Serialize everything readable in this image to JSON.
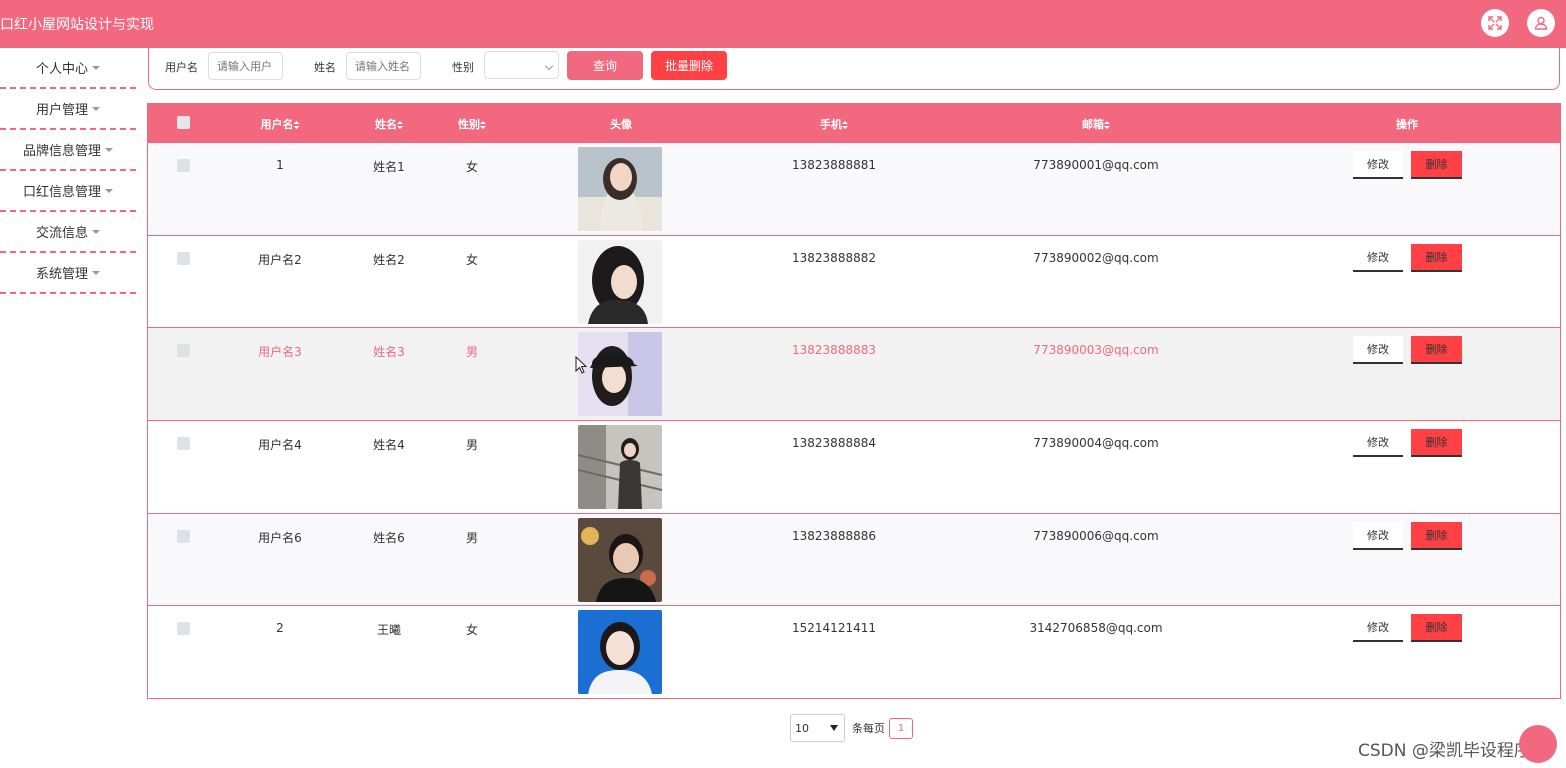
{
  "header": {
    "title": "口红小屋网站设计与实现",
    "fullscreen_icon": "fullscreen-icon",
    "user_icon": "user-icon",
    "accent": "#f2687f"
  },
  "sidebar": {
    "items": [
      {
        "label": "个人中心"
      },
      {
        "label": "用户管理"
      },
      {
        "label": "品牌信息管理"
      },
      {
        "label": "口红信息管理"
      },
      {
        "label": "交流信息"
      },
      {
        "label": "系统管理"
      }
    ]
  },
  "search": {
    "username_label": "用户名",
    "username_placeholder": "请输入用户",
    "name_label": "姓名",
    "name_placeholder": "请输入姓名",
    "gender_label": "性别",
    "gender_value": "",
    "query_button": "查询",
    "batch_delete_button": "批量删除"
  },
  "table": {
    "columns": {
      "username": "用户名",
      "name": "姓名",
      "gender": "性别",
      "avatar": "头像",
      "phone": "手机",
      "email": "邮箱",
      "actions": "操作"
    },
    "edit_label": "修改",
    "delete_label": "删除",
    "rows": [
      {
        "username": "1",
        "name": "姓名1",
        "gender": "女",
        "phone": "13823888881",
        "email": "773890001@qq.com"
      },
      {
        "username": "用户名2",
        "name": "姓名2",
        "gender": "女",
        "phone": "13823888882",
        "email": "773890002@qq.com"
      },
      {
        "username": "用户名3",
        "name": "姓名3",
        "gender": "男",
        "phone": "13823888883",
        "email": "773890003@qq.com"
      },
      {
        "username": "用户名4",
        "name": "姓名4",
        "gender": "男",
        "phone": "13823888884",
        "email": "773890004@qq.com"
      },
      {
        "username": "用户名6",
        "name": "姓名6",
        "gender": "男",
        "phone": "13823888886",
        "email": "773890006@qq.com"
      },
      {
        "username": "2",
        "name": "王曦",
        "gender": "女",
        "phone": "15214121411",
        "email": "3142706858@qq.com"
      }
    ]
  },
  "pagination": {
    "page_size": "10",
    "per_page_label": "条每页",
    "current_page": "1"
  },
  "watermark": "CSDN @梁凯毕设程序"
}
